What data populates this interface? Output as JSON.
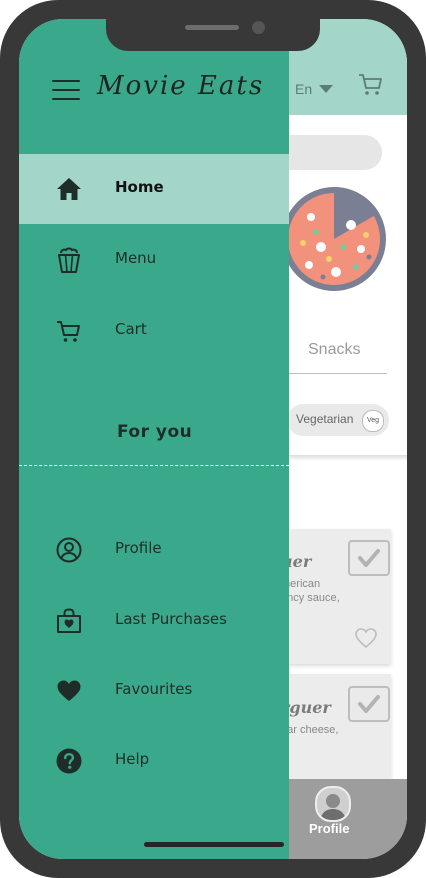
{
  "app": {
    "brand": "Movie Eats"
  },
  "drawer": {
    "nav": [
      {
        "label": "Home",
        "icon": "home-icon",
        "active": true
      },
      {
        "label": "Menu",
        "icon": "popcorn-icon",
        "active": false
      },
      {
        "label": "Cart",
        "icon": "cart-icon",
        "active": false
      }
    ],
    "section_title": "For you",
    "personal": [
      {
        "label": "Profile",
        "icon": "user-circle-icon"
      },
      {
        "label": "Last Purchases",
        "icon": "shopping-bag-icon"
      },
      {
        "label": "Favourites",
        "icon": "heart-icon"
      },
      {
        "label": "Help",
        "icon": "help-icon"
      }
    ]
  },
  "background": {
    "language": "En",
    "category": "Snacks",
    "filter_chip": "Vegetarian",
    "filter_badge": "Veg",
    "cards": [
      {
        "title": "uer",
        "desc_line1": "merican",
        "desc_line2": "ancy sauce,"
      },
      {
        "title": "rguer",
        "desc_line1": "dar cheese,"
      }
    ],
    "bottom_nav_label": "Profile"
  },
  "colors": {
    "drawer": "#3aa98b",
    "active_item": "#a3d6c8",
    "topbar": "#a3d6c8",
    "phone_frame": "#383838"
  }
}
